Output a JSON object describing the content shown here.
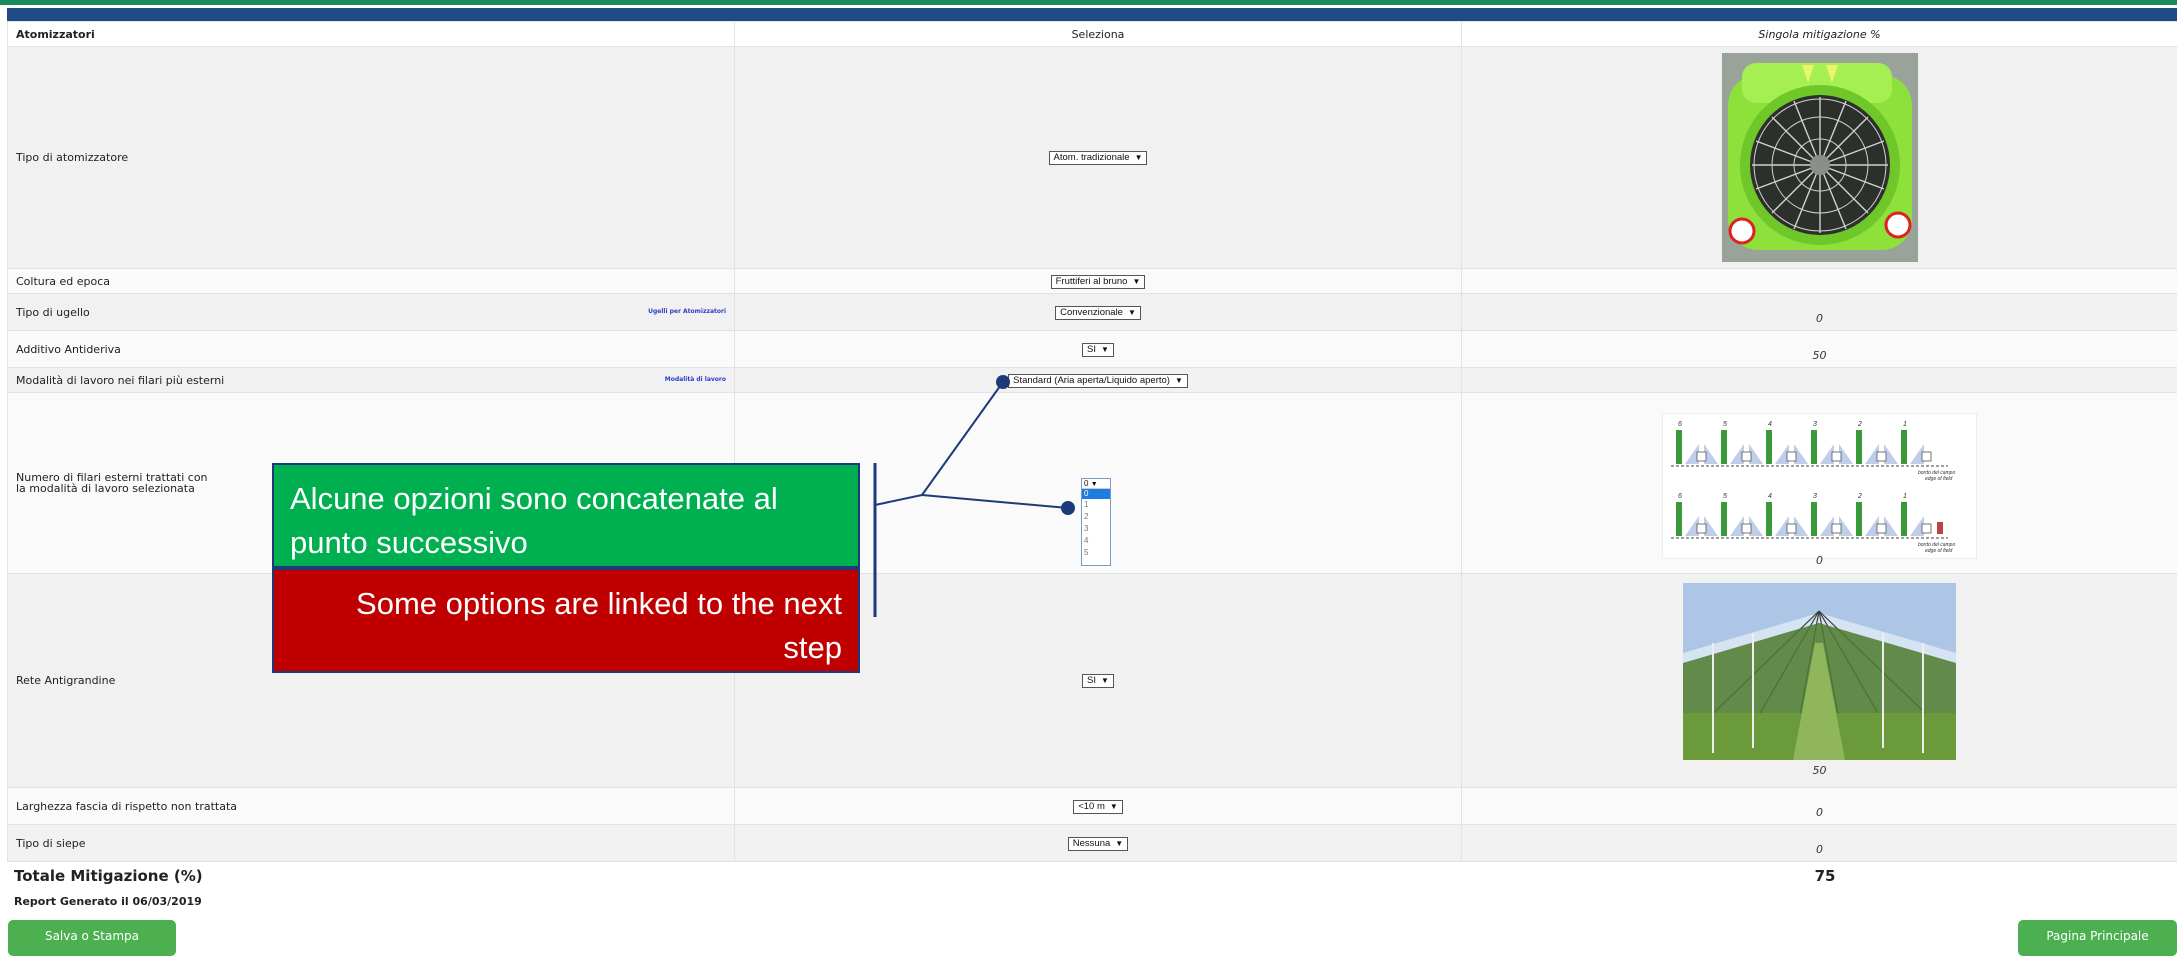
{
  "table": {
    "header": {
      "col1": "Atomizzatori",
      "col2": "Seleziona",
      "col3": "Singola mitigazione %"
    },
    "rows": [
      {
        "label": "Tipo di atomizzatore",
        "select": "Atom. tradizionale",
        "value": ""
      },
      {
        "label": "Coltura ed epoca",
        "select": "Fruttiferi al bruno",
        "value": ""
      },
      {
        "label": "Tipo di ugello",
        "link": "Ugelli per Atomizzatori",
        "select": "Convenzionale",
        "value": "0"
      },
      {
        "label": "Additivo Antideriva",
        "select": "SI",
        "value": "50"
      },
      {
        "label": "Modalità di lavoro nei filari più esterni",
        "link": "Modalità di lavoro",
        "select": "Standard (Aria aperta/Liquido aperto)",
        "value": ""
      },
      {
        "label_line1": "Numero di filari esterni trattati con",
        "label_line2": "la modalità di lavoro selezionata",
        "select": "0",
        "options": [
          "0",
          "1",
          "2",
          "3",
          "4",
          "5"
        ],
        "value": "0"
      },
      {
        "label": "Rete Antigrandine",
        "select": "SI",
        "value": "50"
      },
      {
        "label": "Larghezza fascia di rispetto non trattata",
        "select": "<10 m",
        "value": "0"
      },
      {
        "label": "Tipo di siepe",
        "select": "Nessuna",
        "value": "0"
      }
    ]
  },
  "diagram": {
    "numbers": [
      "6",
      "5",
      "4",
      "3",
      "2",
      "1"
    ],
    "edge1": "bordo del campo",
    "edge1b": "edge of field",
    "edge2": "bordo del campo",
    "edge2b": "edge of field"
  },
  "total": {
    "label": "Totale Mitigazione (%)",
    "value": "75"
  },
  "report": "Report Generato il 06/03/2019",
  "buttons": {
    "save": "Salva o Stampa",
    "home": "Pagina Principale"
  },
  "callout": {
    "it": "Alcune opzioni sono concatenate al punto successivo",
    "en": "Some options are linked to the next step"
  },
  "colors": {
    "green_button": "#4caf50",
    "callout_green": "#00b050",
    "callout_red": "#c00000",
    "header_blue": "#1e4a86"
  }
}
